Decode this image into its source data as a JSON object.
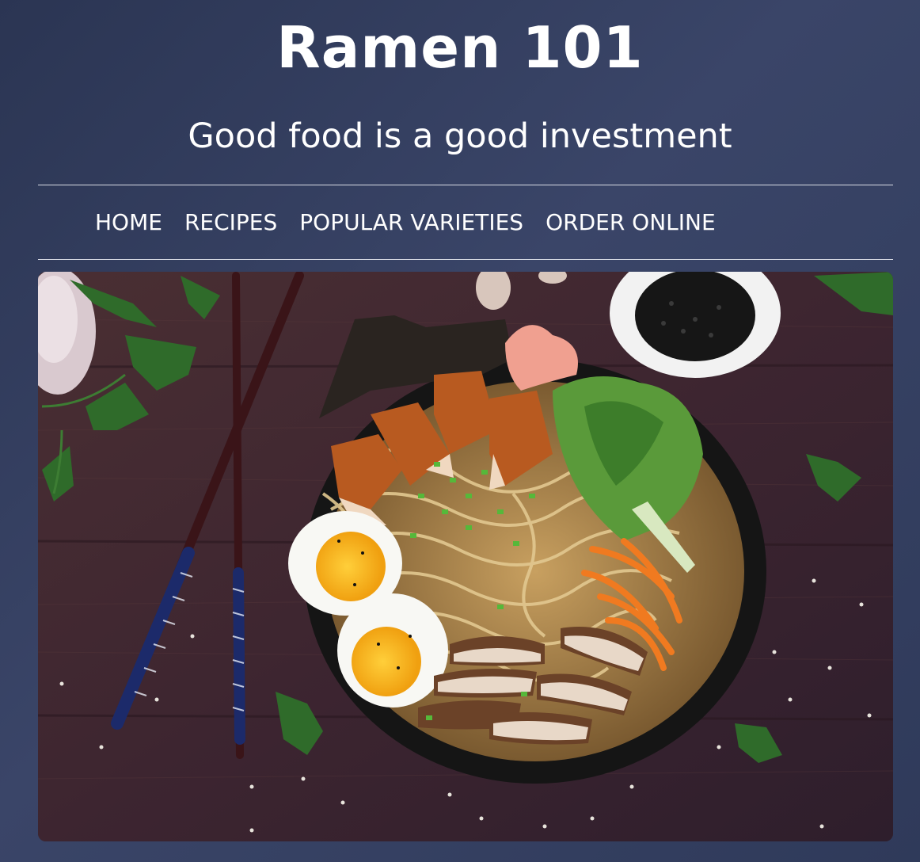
{
  "header": {
    "title": "Ramen 101",
    "tagline": "Good food is a good investment"
  },
  "nav": {
    "items": [
      {
        "label": "HOME"
      },
      {
        "label": "RECIPES"
      },
      {
        "label": "POPULAR VARIETIES"
      },
      {
        "label": "ORDER ONLINE"
      }
    ]
  },
  "hero": {
    "alt": "Bowl of ramen with chicken, soft-boiled eggs, mushrooms, carrots and greens on a wooden table"
  },
  "colors": {
    "background": "#333e60",
    "text": "#ffffff",
    "divider": "#d8dbe4"
  }
}
